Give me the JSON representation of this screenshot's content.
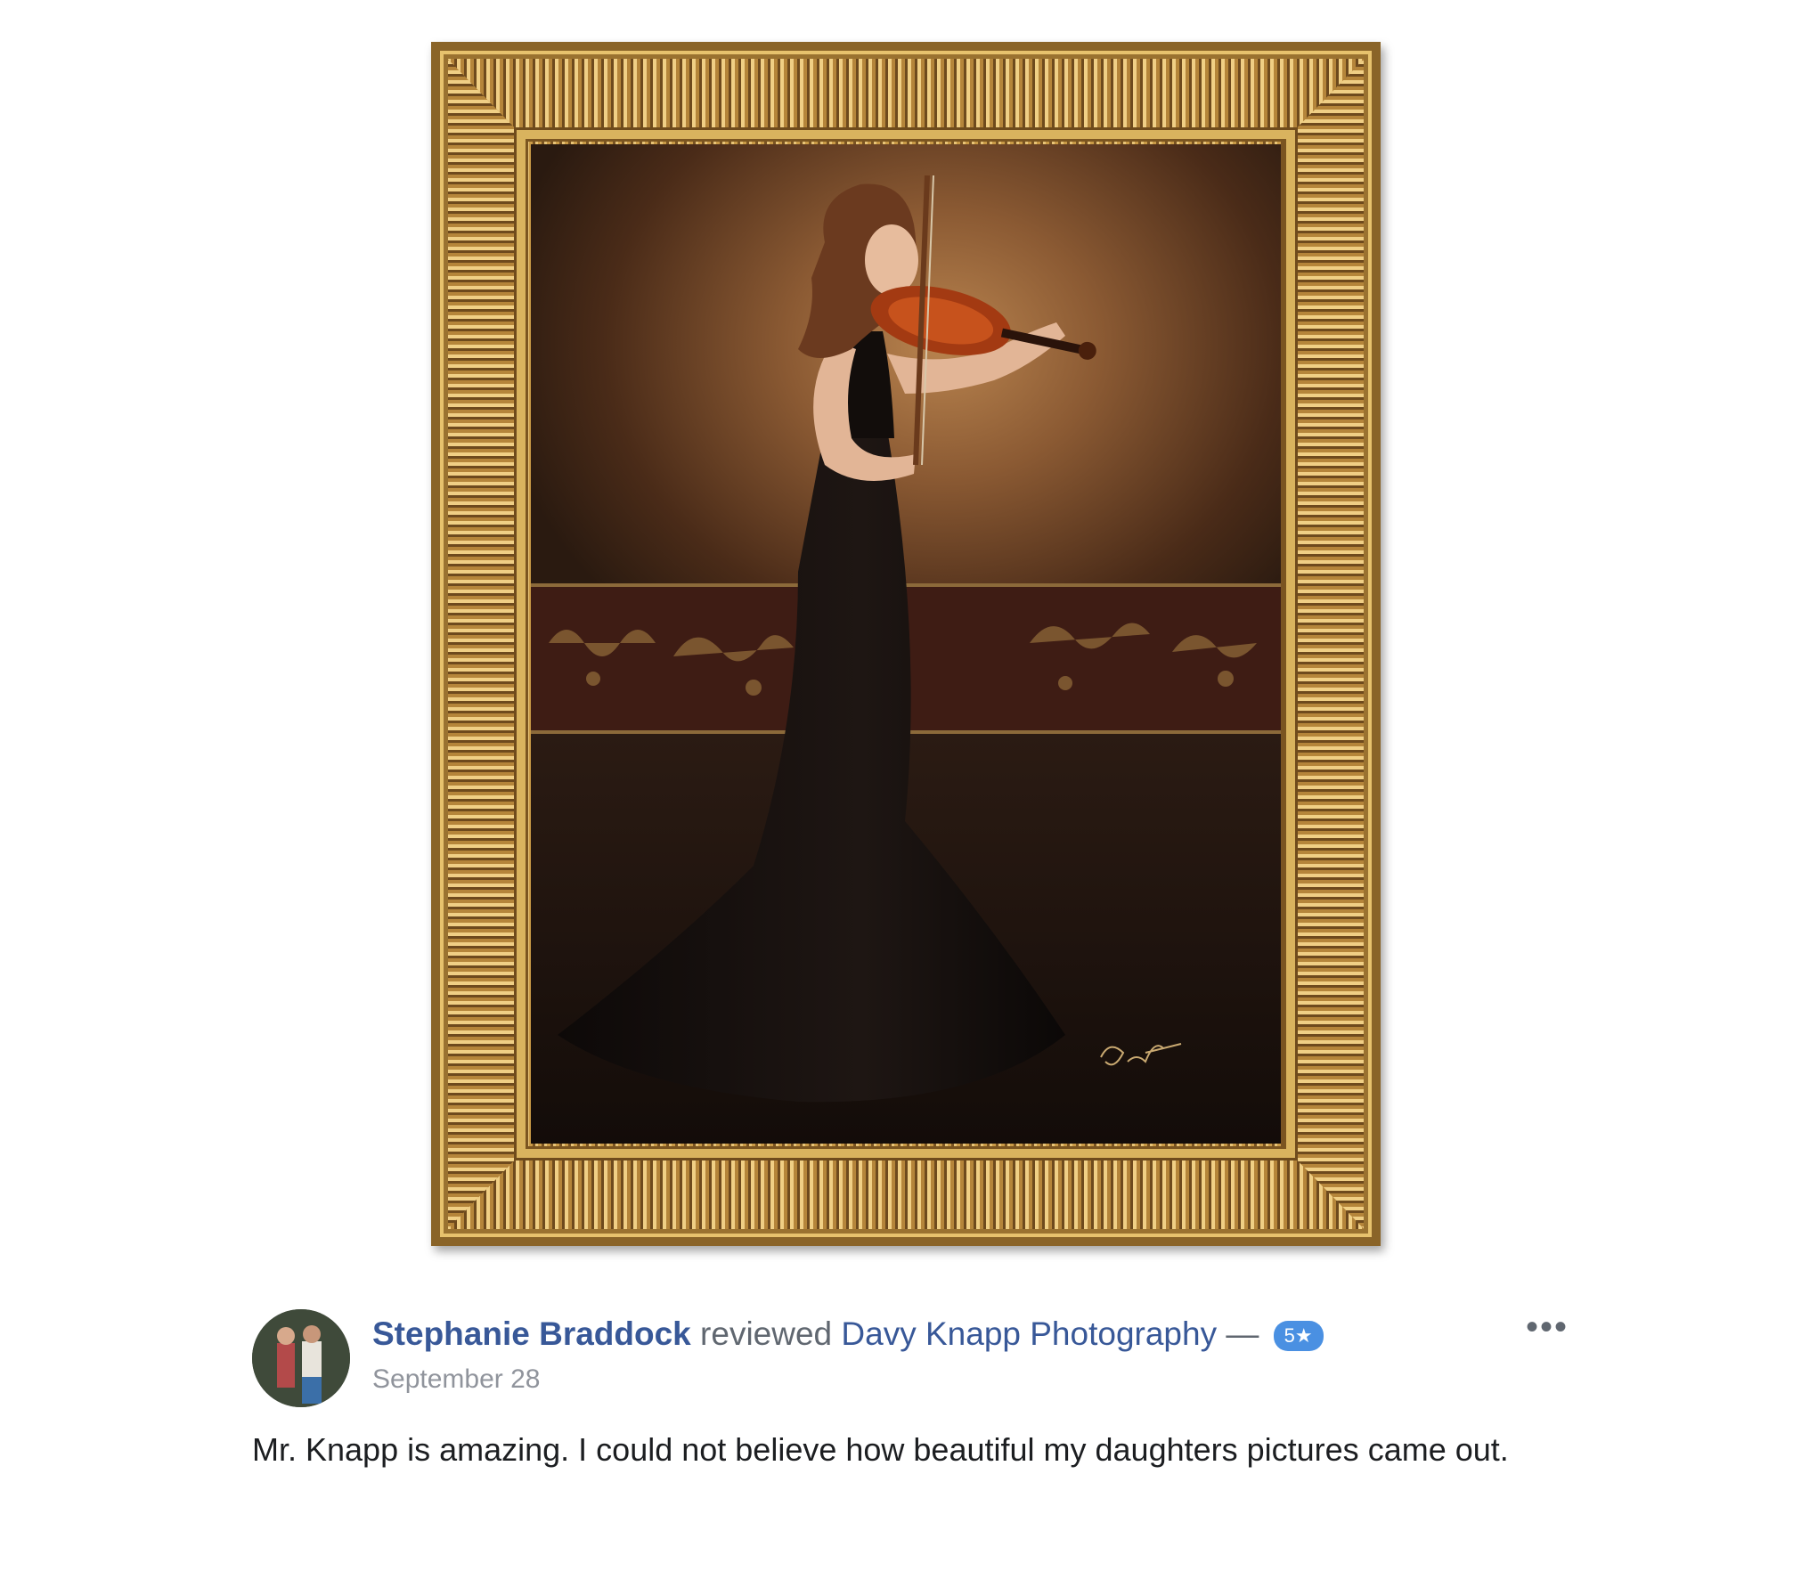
{
  "review": {
    "reviewer_name": "Stephanie Braddock",
    "verb": "reviewed",
    "page_name": "Davy Knapp Photography",
    "separator": "—",
    "rating_label": "5★",
    "date": "September 28",
    "more_label": "•••",
    "text": "Mr. Knapp is amazing. I could not believe how beautiful my daughters pictures came out."
  },
  "colors": {
    "link_blue": "#385898",
    "badge_blue": "#4a90e2",
    "frame_gold": "#c99a46"
  },
  "icons": {
    "more": "more-options-icon",
    "avatar": "user-avatar"
  }
}
